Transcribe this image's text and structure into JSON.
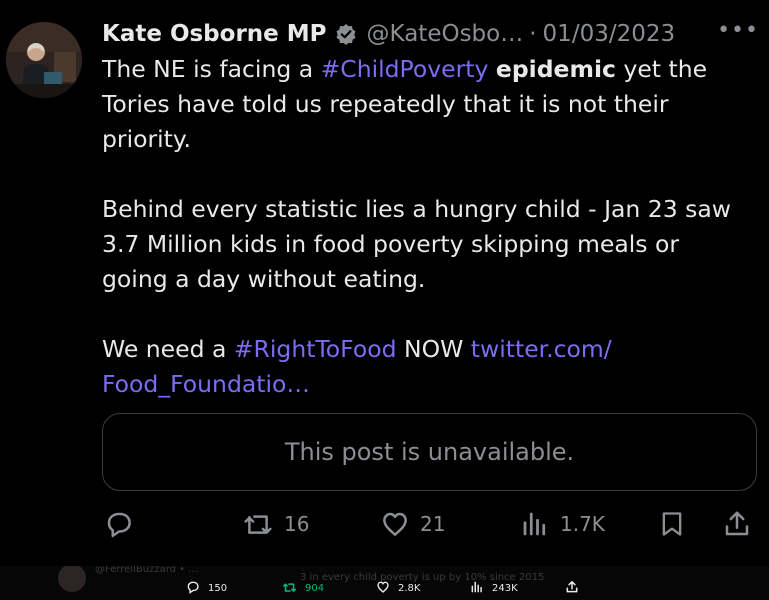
{
  "tweet": {
    "author_name": "Kate Osborne MP",
    "handle": "@KateOsbo…",
    "separator": "·",
    "date": "01/03/2023",
    "more": "•••",
    "verified_icon": "verified-badge-icon",
    "body": {
      "line1_a": "The NE is facing a ",
      "hashtag1": "#ChildPoverty",
      "line1_space": " ",
      "bold_word": "epidemic",
      "line1_b": " yet the Tories have told us repeatedly that it is not their priority.",
      "para2": "Behind every statistic lies a hungry child - Jan 23 saw 3.7 Million kids in food poverty skipping meals or going a day without eating.",
      "para3_a": "We need a ",
      "hashtag2": "#RightToFood",
      "para3_b": " NOW ",
      "link": "twitter.com/ Food_Foundatio…"
    },
    "quote_unavailable": "This post is unavailable.",
    "actions": {
      "reply": {
        "icon": "reply-icon",
        "count": ""
      },
      "retweet": {
        "icon": "retweet-icon",
        "count": "16"
      },
      "like": {
        "icon": "heart-icon",
        "count": "21"
      },
      "views": {
        "icon": "views-icon",
        "count": "1.7K"
      },
      "bookmark": {
        "icon": "bookmark-icon"
      },
      "share": {
        "icon": "share-icon"
      }
    }
  },
  "bottom_bar": {
    "reply_count": "150",
    "retweet_count": "904",
    "like_count": "2.8K",
    "views_count": "243K",
    "faded_text_1": "@FerrellBuzzard • ...",
    "faded_text_2": "3 in every child poverty is up by 10% since 2015"
  },
  "colors": {
    "background": "#000000",
    "text": "#e7e9ea",
    "muted": "#8b8f93",
    "hashtag": "#7c6cf2",
    "retweet_green": "#00ba7c"
  }
}
